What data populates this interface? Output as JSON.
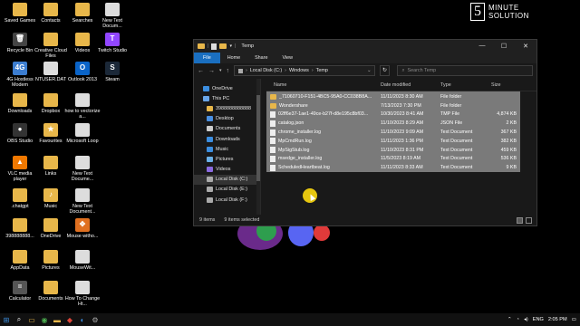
{
  "desktop": {
    "icons": [
      {
        "label": "Saved Games",
        "color": "#e8b74a",
        "glyph": ""
      },
      {
        "label": "Contacts",
        "color": "#e8b74a",
        "glyph": ""
      },
      {
        "label": "Searches",
        "color": "#e8b74a",
        "glyph": ""
      },
      {
        "label": "New Text Docum...",
        "color": "#dddddd",
        "glyph": ""
      },
      {
        "label": "Recycle Bin",
        "color": "#444444",
        "glyph": "🗑"
      },
      {
        "label": "Creative Cloud Files",
        "color": "#e8b74a",
        "glyph": ""
      },
      {
        "label": "Videos",
        "color": "#e8b74a",
        "glyph": ""
      },
      {
        "label": "Twitch Studio",
        "color": "#9146ff",
        "glyph": "T"
      },
      {
        "label": "4G Hostless Modem",
        "color": "#3c7dd0",
        "glyph": "4G"
      },
      {
        "label": "NTUSER.DAT",
        "color": "#dddddd",
        "glyph": ""
      },
      {
        "label": "Outlook 2013",
        "color": "#0a64c8",
        "glyph": "O"
      },
      {
        "label": "Steam",
        "color": "#1b2838",
        "glyph": "S"
      },
      {
        "label": "Downloads",
        "color": "#e8b74a",
        "glyph": ""
      },
      {
        "label": "Dropbox",
        "color": "#e8b74a",
        "glyph": ""
      },
      {
        "label": "how to vectorize a...",
        "color": "#dddddd",
        "glyph": ""
      },
      {
        "label": "OBS Studio",
        "color": "#333333",
        "glyph": "●"
      },
      {
        "label": "Favourites",
        "color": "#e8b74a",
        "glyph": "★"
      },
      {
        "label": "Microsoft Loop",
        "color": "#dddddd",
        "glyph": ""
      },
      {
        "label": "VLC media player",
        "color": "#f07800",
        "glyph": "▲"
      },
      {
        "label": "Links",
        "color": "#e8b74a",
        "glyph": ""
      },
      {
        "label": "New Text Docume...",
        "color": "#dddddd",
        "glyph": ""
      },
      {
        "label": ".chatgpt",
        "color": "#e8b74a",
        "glyph": ""
      },
      {
        "label": "Music",
        "color": "#e8b74a",
        "glyph": "♪"
      },
      {
        "label": "New Text Document...",
        "color": "#dddddd",
        "glyph": ""
      },
      {
        "label": "398888888...",
        "color": "#e8b74a",
        "glyph": ""
      },
      {
        "label": "OneDrive",
        "color": "#e8b74a",
        "glyph": ""
      },
      {
        "label": "Mouse witho...",
        "color": "#e07020",
        "glyph": "✥"
      },
      {
        "label": "AppData",
        "color": "#e8b74a",
        "glyph": ""
      },
      {
        "label": "Pictures",
        "color": "#e8b74a",
        "glyph": ""
      },
      {
        "label": "MouseWit...",
        "color": "#dddddd",
        "glyph": ""
      },
      {
        "label": "Calculator",
        "color": "#555555",
        "glyph": "="
      },
      {
        "label": "Documents",
        "color": "#e8b74a",
        "glyph": ""
      },
      {
        "label": "How To Change Ht...",
        "color": "#dddddd",
        "glyph": ""
      }
    ]
  },
  "logo": {
    "number": "5",
    "line1": "MINUTE",
    "line2": "SOLUTION"
  },
  "window": {
    "title": "Temp",
    "ribbon": [
      "File",
      "Home",
      "Share",
      "View"
    ],
    "address": [
      "Local Disk (C:)",
      "Windows",
      "Temp"
    ],
    "search_placeholder": "Search Temp",
    "nav_items": [
      {
        "label": "OneDrive",
        "color": "#3c8ee0",
        "sub": false,
        "selected": false
      },
      {
        "label": "This PC",
        "color": "#6aa6e8",
        "sub": false,
        "selected": false
      },
      {
        "label": "3988888888888",
        "color": "#e8b74a",
        "sub": true,
        "selected": false
      },
      {
        "label": "Desktop",
        "color": "#4a90e2",
        "sub": true,
        "selected": false
      },
      {
        "label": "Documents",
        "color": "#cccccc",
        "sub": true,
        "selected": false
      },
      {
        "label": "Downloads",
        "color": "#3c8ee0",
        "sub": true,
        "selected": false
      },
      {
        "label": "Music",
        "color": "#3c8ee0",
        "sub": true,
        "selected": false
      },
      {
        "label": "Pictures",
        "color": "#6ab0e8",
        "sub": true,
        "selected": false
      },
      {
        "label": "Videos",
        "color": "#8a6ae0",
        "sub": true,
        "selected": false
      },
      {
        "label": "Local Disk (C:)",
        "color": "#aaaaaa",
        "sub": true,
        "selected": true
      },
      {
        "label": "Local Disk (E:)",
        "color": "#aaaaaa",
        "sub": true,
        "selected": false
      },
      {
        "label": "Local Disk (F:)",
        "color": "#aaaaaa",
        "sub": true,
        "selected": false
      }
    ],
    "columns": [
      "Name",
      "Date modified",
      "Type",
      "Size"
    ],
    "files": [
      {
        "name": "_71060710-F151-4BC5-95A0-CC038B8A...",
        "date": "11/11/2023 8:30 AM",
        "type": "File folder",
        "size": "",
        "kind": "folder"
      },
      {
        "name": "Wondershare",
        "date": "7/13/2023 7:30 PM",
        "type": "File folder",
        "size": "",
        "kind": "folder"
      },
      {
        "name": "02ff6e37-1ae1-49ce-b27f-d8e195c8bf03...",
        "date": "10/30/2023 8:41 AM",
        "type": "TMP File",
        "size": "4,874 KB",
        "kind": "file"
      },
      {
        "name": "catalog.json",
        "date": "11/10/2023 8:29 AM",
        "type": "JSON File",
        "size": "2 KB",
        "kind": "file"
      },
      {
        "name": "chrome_installer.log",
        "date": "11/10/2023 9:09 AM",
        "type": "Text Document",
        "size": "367 KB",
        "kind": "file"
      },
      {
        "name": "MpCmdRun.log",
        "date": "11/11/2023 1:36 PM",
        "type": "Text Document",
        "size": "382 KB",
        "kind": "file"
      },
      {
        "name": "MpSigStub.log",
        "date": "11/10/2023 8:31 PM",
        "type": "Text Document",
        "size": "459 KB",
        "kind": "file"
      },
      {
        "name": "msedge_installer.log",
        "date": "11/5/2023 8:19 AM",
        "type": "Text Document",
        "size": "536 KB",
        "kind": "file"
      },
      {
        "name": "ScheduledHeartbeat.log",
        "date": "11/11/2023 8:33 AM",
        "type": "Text Document",
        "size": "9 KB",
        "kind": "file"
      }
    ],
    "status_items": "9 items",
    "status_selected": "9 items selected"
  },
  "taskbar": {
    "language": "ENG",
    "time": "2:05 PM"
  }
}
